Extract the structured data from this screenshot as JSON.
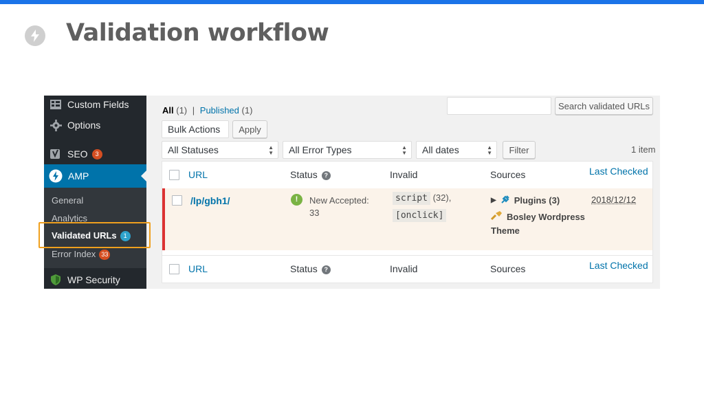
{
  "slide": {
    "title": "Validation workflow",
    "icon": "bolt-icon",
    "accent_color": "#1a73e8"
  },
  "sidebar": {
    "items": [
      {
        "label": "Custom Fields",
        "icon": "custom-fields-icon"
      },
      {
        "label": "Options",
        "icon": "gear-icon"
      },
      {
        "label": "SEO",
        "icon": "yoast-icon",
        "badge": "3"
      }
    ],
    "amp": {
      "label": "AMP",
      "icon": "amp-bolt-icon"
    },
    "submenu": [
      {
        "label": "General"
      },
      {
        "label": "Analytics"
      },
      {
        "label": "Validated URLs",
        "badge": "1",
        "current": true
      },
      {
        "label": "Error Index",
        "badge": "33"
      }
    ],
    "after": {
      "label": "WP Security",
      "icon": "shield-icon"
    }
  },
  "views": {
    "all_label": "All",
    "all_count": "(1)",
    "separator": "|",
    "published_label": "Published",
    "published_count": "(1)"
  },
  "search": {
    "value": "",
    "button_label": "Search validated URLs"
  },
  "bulk": {
    "select_value": "Bulk Actions",
    "apply_label": "Apply"
  },
  "filters": {
    "status": "All Statuses",
    "error_types": "All Error Types",
    "dates": "All dates",
    "filter_label": "Filter",
    "item_count": "1 item"
  },
  "table": {
    "columns": {
      "url": "URL",
      "status": "Status",
      "invalid": "Invalid",
      "sources": "Sources",
      "last_checked": "Last Checked"
    },
    "row": {
      "url": "/lp/gbh1/",
      "status_line1": "New Accepted:",
      "status_line2": "33",
      "invalid_code1": "script",
      "invalid_count1": "(32),",
      "invalid_code2": "[onclick]",
      "sources_plugins": "Plugins (3)",
      "sources_theme1": "Bosley Wordpress",
      "sources_theme2": "Theme",
      "last_checked": "2018/12/12"
    }
  }
}
